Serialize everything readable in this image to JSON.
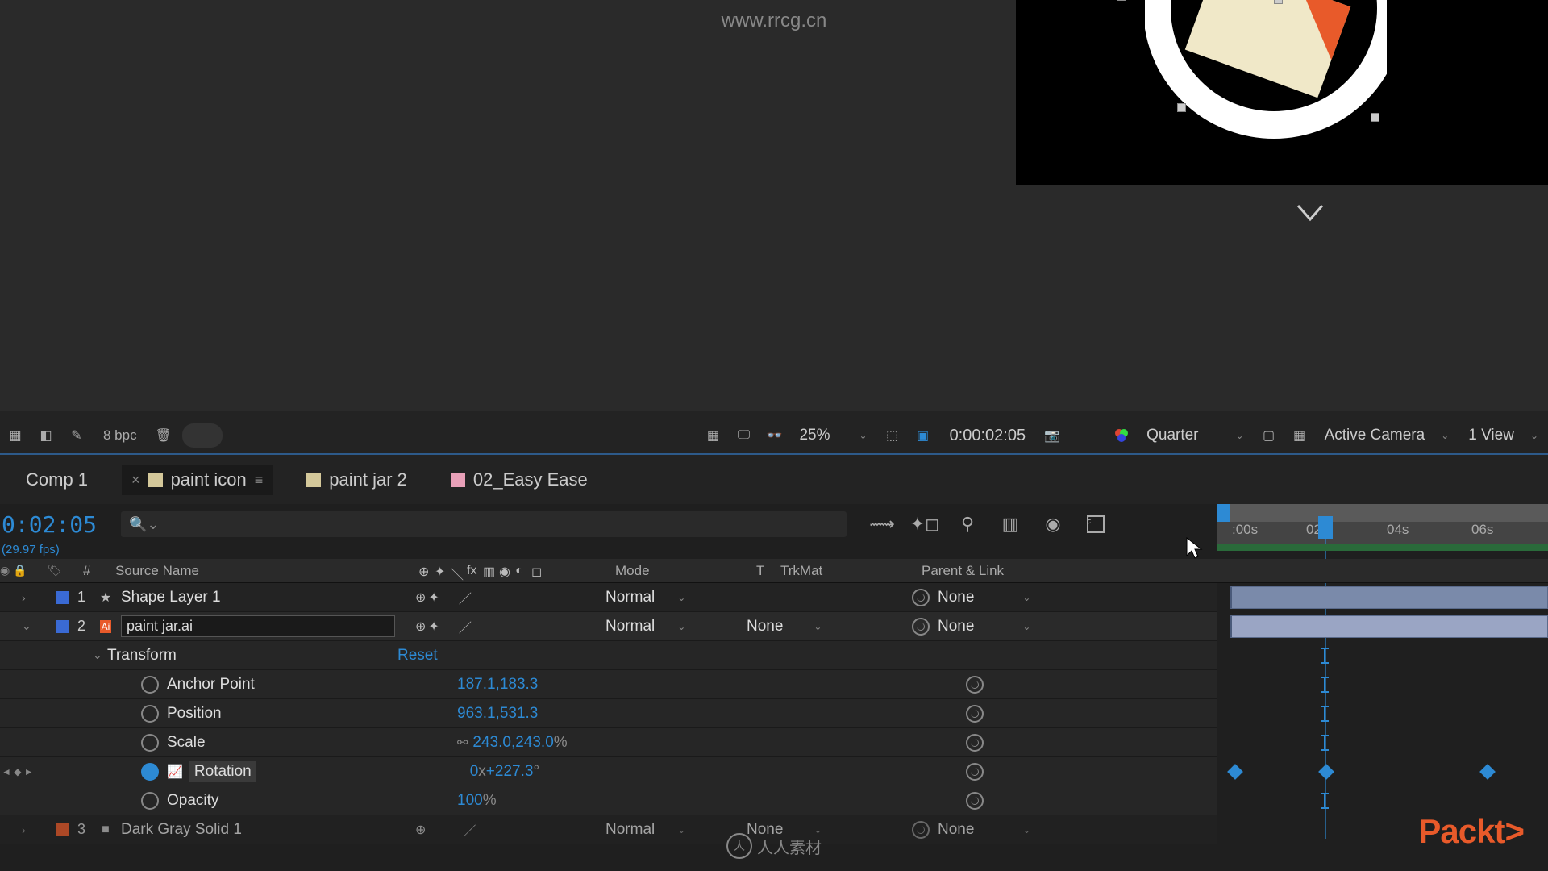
{
  "watermark": {
    "url": "www.rrcg.cn",
    "brand": "Packt>",
    "center": "人人素材"
  },
  "footer_toolbar": {
    "bpc": "8 bpc",
    "zoom": "25%",
    "timecode": "0:00:02:05",
    "resolution": "Quarter",
    "camera": "Active Camera",
    "view": "1 View"
  },
  "tabs": [
    {
      "label": "Comp 1",
      "active": false,
      "close": false,
      "swatch": null
    },
    {
      "label": "paint icon",
      "active": true,
      "close": true,
      "swatch": "#d4c89a",
      "menu": true
    },
    {
      "label": "paint jar 2",
      "active": false,
      "close": false,
      "swatch": "#d4c89a"
    },
    {
      "label": "02_Easy Ease",
      "active": false,
      "close": false,
      "swatch": "#e8a0b8"
    }
  ],
  "timeline": {
    "timecode": "0:02:05",
    "fps": "(29.97 fps)",
    "ruler": [
      ":00s",
      "02",
      "04s",
      "06s"
    ]
  },
  "columns": {
    "num": "#",
    "source_name": "Source Name",
    "mode": "Mode",
    "t": "T",
    "trkmat": "TrkMat",
    "parent": "Parent & Link"
  },
  "layers": [
    {
      "num": "1",
      "name": "Shape Layer 1",
      "color": "#3a6ad4",
      "mode": "Normal",
      "trkmat": "",
      "parent": "None",
      "icon": "star"
    },
    {
      "num": "2",
      "name": "paint jar.ai",
      "color": "#3a6ad4",
      "mode": "Normal",
      "trkmat": "None",
      "parent": "None",
      "icon": "ai",
      "editing": true,
      "expanded": true
    },
    {
      "num": "3",
      "name": "Dark Gray Solid 1",
      "color": "#e85a2a",
      "mode": "Normal",
      "trkmat": "None",
      "parent": "None",
      "icon": "solid"
    }
  ],
  "transform": {
    "label": "Transform",
    "reset": "Reset",
    "anchor_point": {
      "label": "Anchor Point",
      "value": "187.1,183.3"
    },
    "position": {
      "label": "Position",
      "value": "963.1,531.3"
    },
    "scale": {
      "label": "Scale",
      "value": "243.0,243.0",
      "unit": "%"
    },
    "rotation": {
      "label": "Rotation",
      "value_x": "0",
      "x_label": "x",
      "value_deg": "+227.3",
      "deg": "°",
      "keyed": true
    },
    "opacity": {
      "label": "Opacity",
      "value": "100",
      "unit": "%"
    }
  }
}
